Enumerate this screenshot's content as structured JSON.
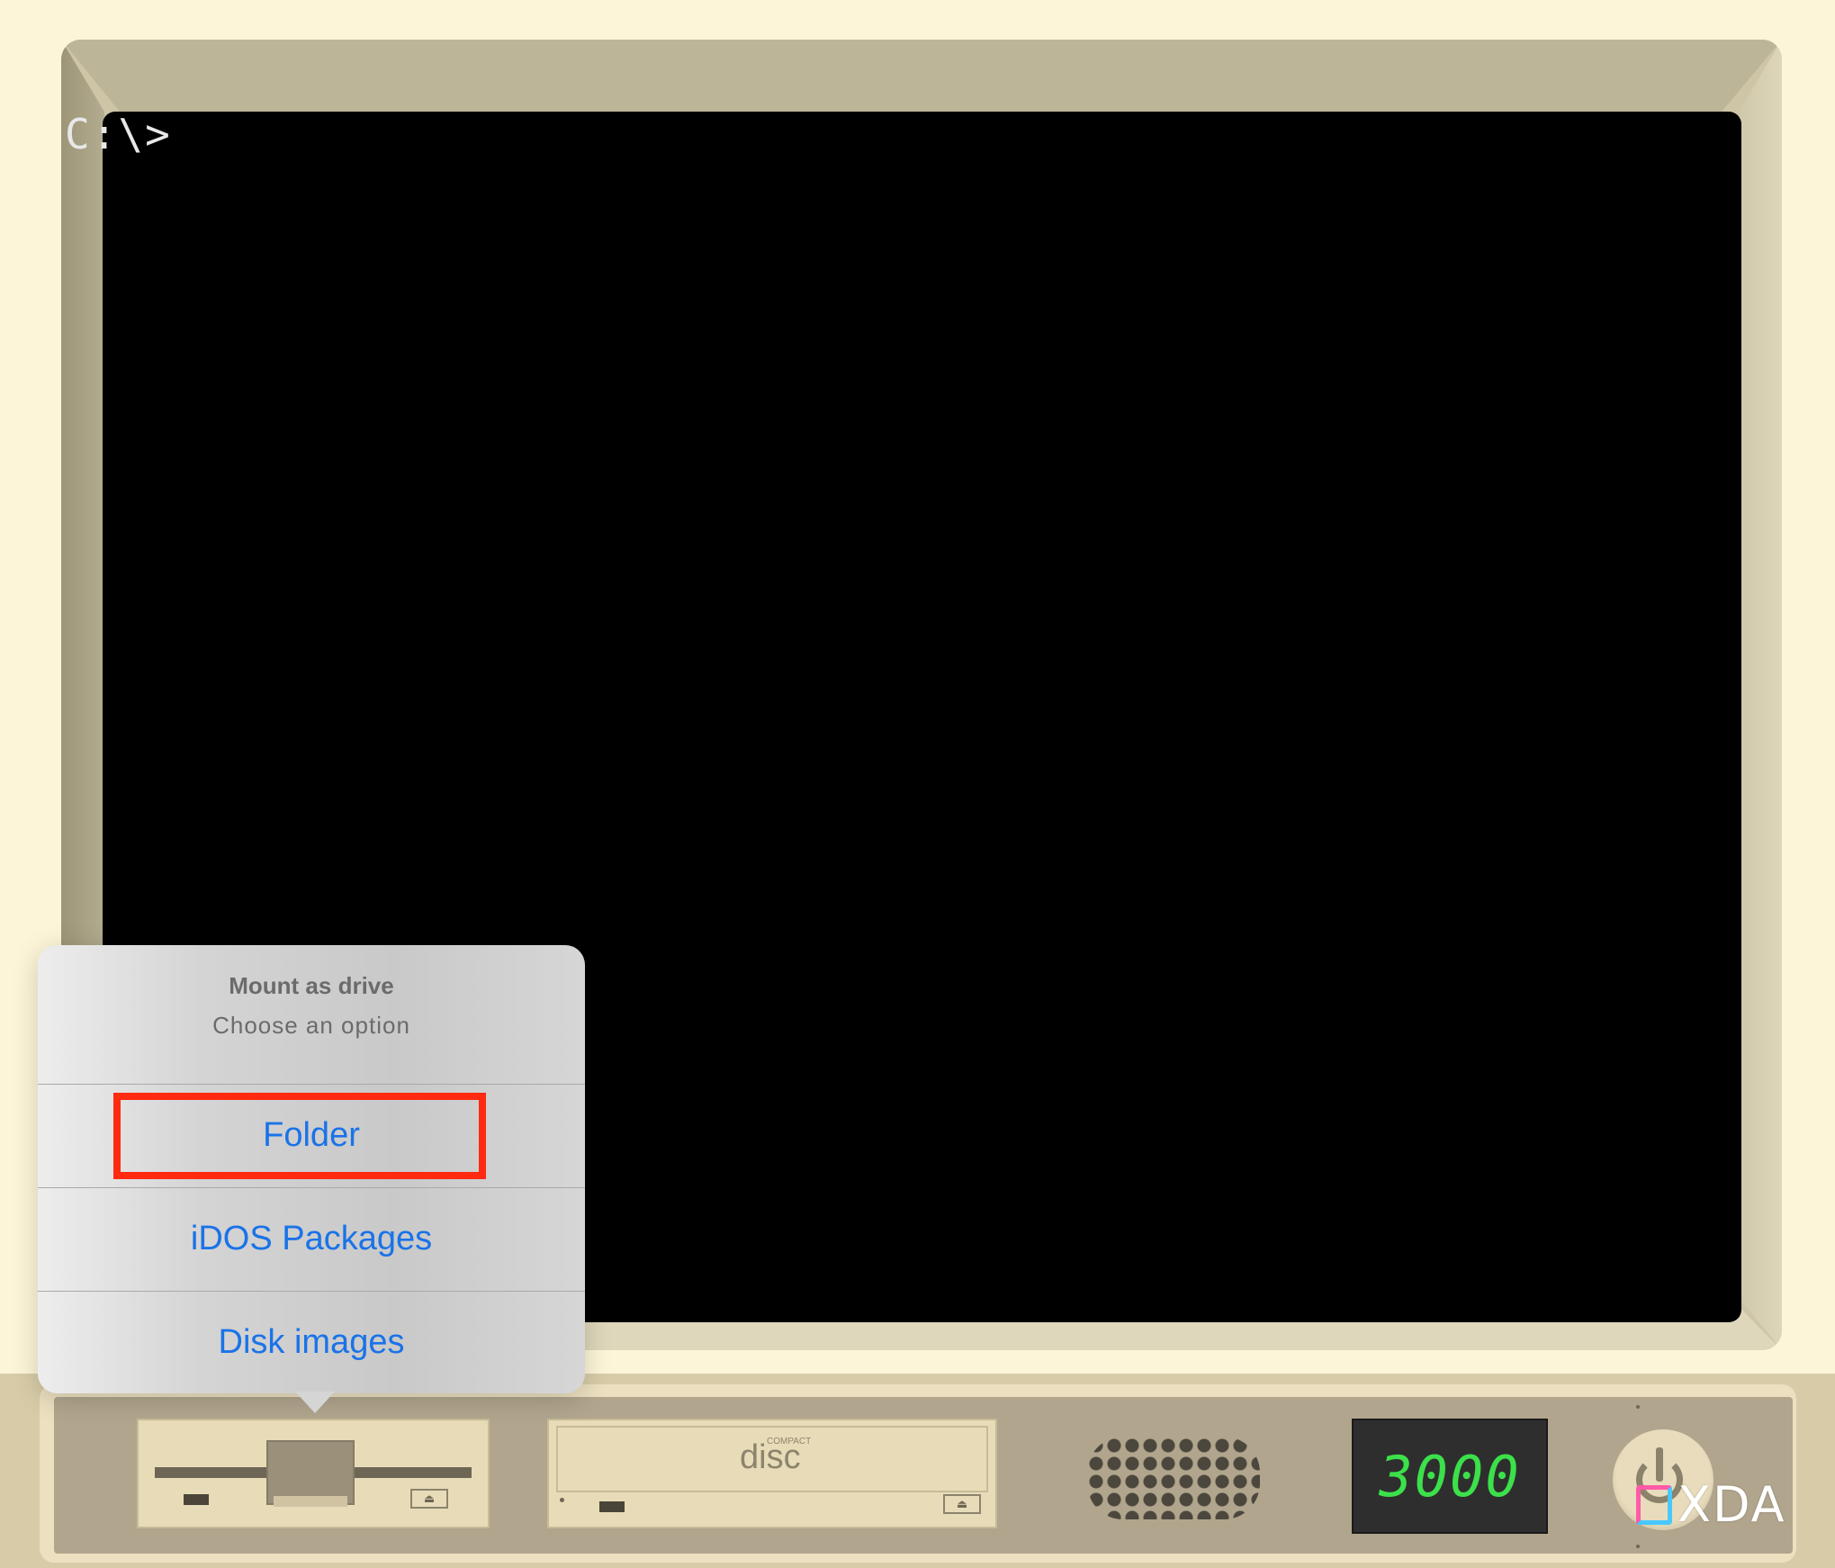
{
  "screen": {
    "prompt": "C:\\>"
  },
  "popover": {
    "title": "Mount as drive",
    "subtitle": "Choose an option",
    "options": [
      {
        "label": "Folder"
      },
      {
        "label": "iDOS Packages"
      },
      {
        "label": "Disk images"
      }
    ],
    "highlighted_option": "Folder",
    "option_color": "#1a73e8",
    "highlight_color": "#ff2a10"
  },
  "front_panel": {
    "cd_logo_main": "disc",
    "cd_logo_small": "COMPACT",
    "display_value": "3000",
    "display_color": "#3ce04a",
    "floppy_eject_icon": "eject-icon",
    "cd_eject_icon": "eject-icon",
    "power_icon": "power-icon"
  },
  "watermark": {
    "text": "XDA"
  }
}
